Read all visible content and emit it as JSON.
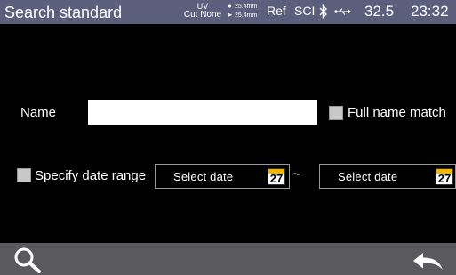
{
  "status_bar": {
    "title": "Search standard",
    "uv_label": "UV",
    "cut_label": "Cut None",
    "fiber_top": "25.4mm",
    "fiber_bottom": "25.4mm",
    "ref": "Ref",
    "sci": "SCI",
    "temperature": "32.5",
    "clock": "23:32",
    "icons": [
      "bluetooth-icon",
      "usb-icon"
    ],
    "background": "#5b5f7c"
  },
  "form": {
    "name_label": "Name",
    "name_value": "",
    "full_name_match_label": "Full name match",
    "full_name_match_checked": false,
    "date_range_label": "Specify date range",
    "date_range_checked": false,
    "start_date_text": "Select date",
    "end_date_text": "Select date",
    "calendar_day": "27",
    "range_separator": "~"
  },
  "bottom_bar": {
    "icons": [
      "search-icon",
      "back-arrow-icon"
    ],
    "background": "#5a5a5e"
  }
}
